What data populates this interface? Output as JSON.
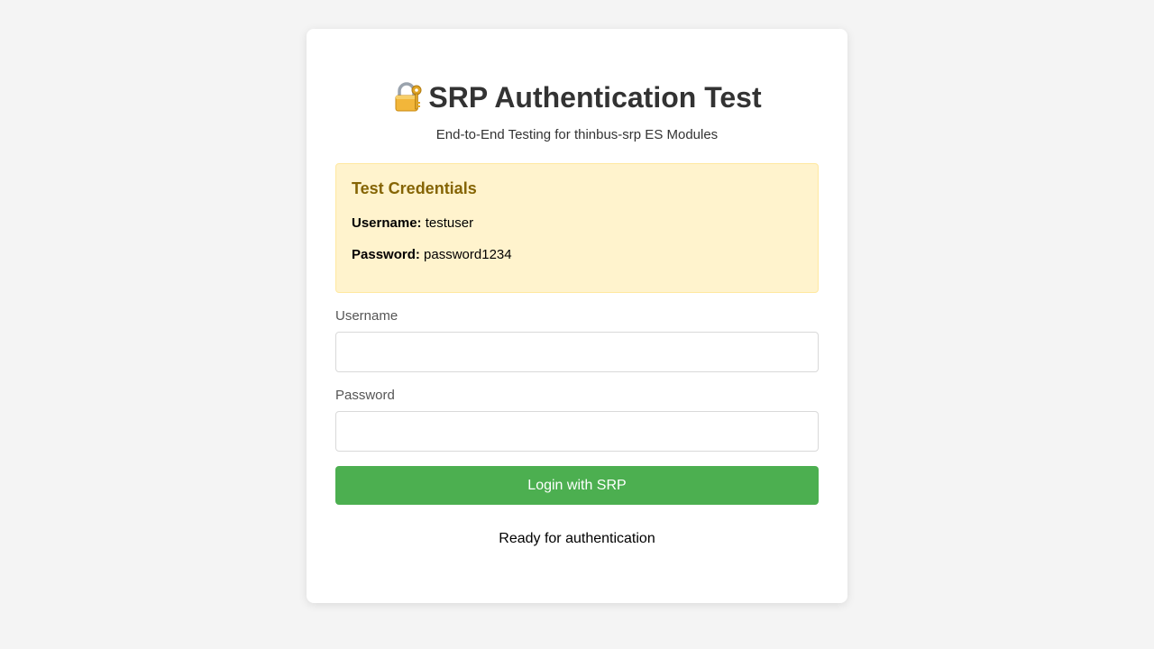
{
  "header": {
    "icon": "locked-with-key-icon",
    "title": "SRP Authentication Test",
    "subtitle": "End-to-End Testing for thinbus-srp ES Modules"
  },
  "credentials": {
    "title": "Test Credentials",
    "username_label": "Username:",
    "username_value": "testuser",
    "password_label": "Password:",
    "password_value": "password1234"
  },
  "form": {
    "username_label": "Username",
    "username_value": "",
    "password_label": "Password",
    "password_value": "",
    "submit_label": "Login with SRP"
  },
  "status": {
    "message": "Ready for authentication"
  },
  "colors": {
    "background": "#f4f4f4",
    "card": "#ffffff",
    "accent": "#4caf50",
    "credentials_bg": "#fff3cd",
    "credentials_title": "#856404"
  }
}
